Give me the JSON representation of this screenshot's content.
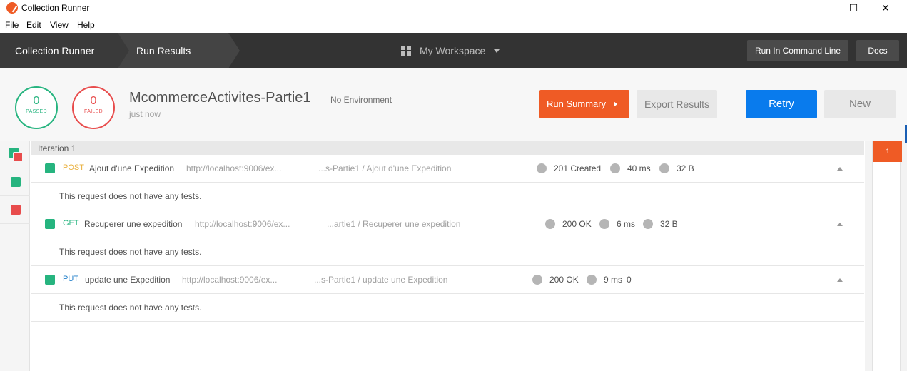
{
  "window": {
    "title": "Collection Runner",
    "min": "—",
    "max": "☐",
    "close": "✕"
  },
  "menu": [
    "File",
    "Edit",
    "View",
    "Help"
  ],
  "nav": {
    "crumbs": [
      "Collection Runner",
      "Run Results"
    ],
    "workspace": "My Workspace",
    "run_cli": "Run In Command Line",
    "docs": "Docs"
  },
  "summary": {
    "passed": {
      "count": "0",
      "label": "PASSED"
    },
    "failed": {
      "count": "0",
      "label": "FAILED"
    },
    "collection": "McommerceActivites-Partie1",
    "environment": "No Environment",
    "time": "just now",
    "run_summary": "Run Summary",
    "export": "Export Results",
    "retry": "Retry",
    "new": "New"
  },
  "iteration": "Iteration 1",
  "requests": [
    {
      "method": "POST",
      "method_color": "#e9b03d",
      "name": "Ajout d'une Expedition",
      "url": "http://localhost:9006/ex...",
      "path": "...s-Partie1 / Ajout d'une Expedition",
      "status": "201 Created",
      "time": "40 ms",
      "size": "32 B",
      "tests": "This request does not have any tests."
    },
    {
      "method": "GET",
      "method_color": "#26b47f",
      "name": "Recuperer une expedition",
      "url": "http://localhost:9006/ex...",
      "path": "...artie1 / Recuperer une expedition",
      "status": "200 OK",
      "time": "6 ms",
      "size": "32 B",
      "tests": "This request does not have any tests."
    },
    {
      "method": "PUT",
      "method_color": "#1f7ec9",
      "name": "update une Expedition",
      "url": "http://localhost:9006/ex...",
      "path": "...s-Partie1 / update une Expedition",
      "status": "200 OK",
      "time": "9 ms",
      "size": "0",
      "tests": "This request does not have any tests."
    }
  ],
  "iteration_marker": "1",
  "colors": {
    "accent": "#ef5b25",
    "pass": "#26b47f",
    "fail": "#e84c4c",
    "primary": "#097bed"
  }
}
